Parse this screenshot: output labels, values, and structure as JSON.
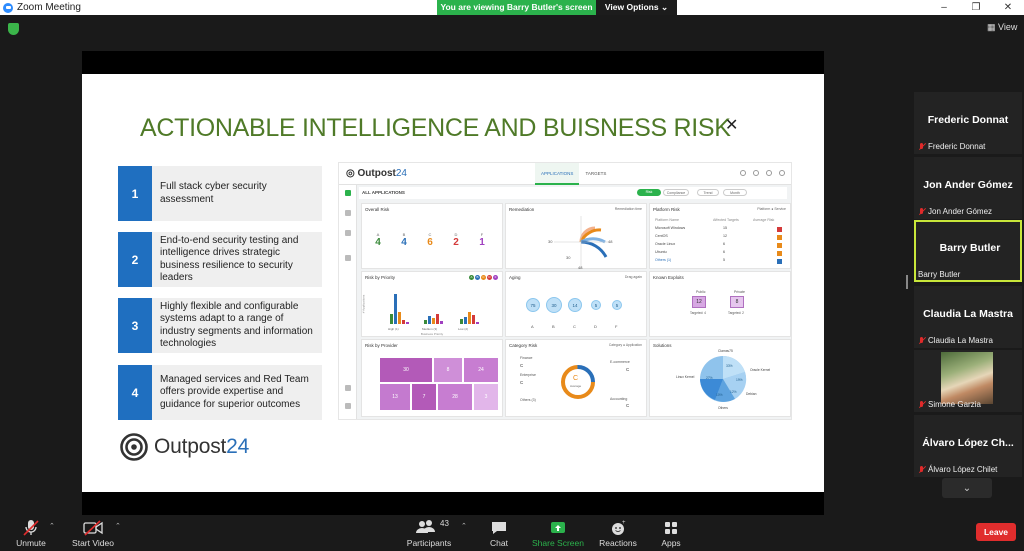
{
  "window": {
    "title": "Zoom Meeting",
    "controls": [
      "–",
      "❐",
      "✕"
    ]
  },
  "share_bar": {
    "message": "You are viewing Barry Butler's screen",
    "view_options": "View Options ⌄"
  },
  "view_button": "View",
  "slide": {
    "title": "ACTIONABLE INTELLIGENCE AND BUISNESS RISK",
    "points": [
      {
        "num": "1",
        "text": "Full stack cyber security assessment"
      },
      {
        "num": "2",
        "text": "End-to-end security testing and intelligence drives strategic business resilience to security leaders"
      },
      {
        "num": "3",
        "text": "Highly flexible and configurable systems adapt to a range of industry segments and information technologies"
      },
      {
        "num": "4",
        "text": "Managed services and Red Team offers provide expertise and guidance for superior outcomes"
      }
    ],
    "logo": {
      "part1": "Outpost",
      "part2": "24"
    }
  },
  "dashboard": {
    "logo_part1": "Outpost",
    "logo_part2": "24",
    "tabs": [
      "APPLICATIONS",
      "TARGETS"
    ],
    "subheader": "ALL APPLICATIONS",
    "toggles": [
      "Risk",
      "Compliance",
      "Trend",
      "Month"
    ],
    "overall_risk": {
      "title": "Overall Risk",
      "items": [
        {
          "label": "A",
          "value": "4",
          "color": "#3a8a3a"
        },
        {
          "label": "B",
          "value": "4",
          "color": "#2a6fb8"
        },
        {
          "label": "C",
          "value": "6",
          "color": "#e88a1a"
        },
        {
          "label": "D",
          "value": "2",
          "color": "#d43a3a"
        },
        {
          "label": "F",
          "value": "1",
          "color": "#a040c0"
        }
      ]
    },
    "remediation": {
      "title": "Remediation",
      "link": "Remediation time",
      "axis": [
        "30",
        "30",
        "48",
        "48"
      ]
    },
    "platform_risk": {
      "title": "Platform Risk",
      "toggle_a": "Platform",
      "toggle_b": "Service",
      "headers": [
        "Platform Name",
        "Affected Targets",
        "Average Risk"
      ],
      "rows": [
        {
          "name": "Microsoft Windows",
          "count": "15",
          "color": "#d43a3a"
        },
        {
          "name": "CentOS",
          "count": "12",
          "color": "#e88a1a"
        },
        {
          "name": "Oracle Linux",
          "count": "6",
          "color": "#e88a1a"
        },
        {
          "name": "Ubuntu",
          "count": "6",
          "color": "#e88a1a"
        },
        {
          "name": "Others (1)",
          "count": "5",
          "color": "#2a6fb8"
        }
      ]
    },
    "risk_by_priority": {
      "title": "Risk by Priority",
      "groups": [
        "High (1)",
        "Medium (3)",
        "Low (2)"
      ],
      "xlabel": "Business Priority",
      "ylabel": "# Applications",
      "legend": [
        "A",
        "B",
        "C",
        "D",
        "F"
      ]
    },
    "aging": {
      "title": "Aging",
      "link": "Drag again",
      "circles": [
        "75",
        "30",
        "14",
        "5",
        "5"
      ],
      "labels": [
        "A",
        "B",
        "C",
        "D",
        "F"
      ],
      "extra": "104"
    },
    "known_exploits": {
      "title": "Known Exploits",
      "public_label": "Public",
      "public_value": "12",
      "public_sub": "Targeted: 4",
      "private_label": "Private",
      "private_value": "8",
      "private_sub": "Targeted: 2"
    },
    "risk_by_provider": {
      "title": "Risk by Provider",
      "cells": [
        "30",
        "8",
        "24",
        "13",
        "7",
        "28",
        "3"
      ]
    },
    "category_risk": {
      "title": "Category Risk",
      "toggle_a": "Category",
      "toggle_b": "Application",
      "left": [
        "Finance",
        "C",
        "Enterprise",
        "C",
        "Others (3)"
      ],
      "right": [
        "E-commerce",
        "C",
        "Accounting",
        "C"
      ],
      "center_grade": "C",
      "center_sub": "Average"
    },
    "solutions": {
      "title": "Solutions",
      "labels": [
        "Clamav75",
        "Oracle Kernel",
        "Linux Kernel",
        "Debian",
        "Others"
      ],
      "pcts": [
        "33%",
        "19%",
        "27%",
        "12%",
        "10%"
      ]
    }
  },
  "participants": [
    {
      "name": "Frederic Donnat",
      "label": "Frederic Donnat",
      "muted": true
    },
    {
      "name": "Jon Ander Gómez",
      "label": "Jon Ander Gómez",
      "muted": true
    },
    {
      "name": "Barry Butler",
      "label": "Barry Butler",
      "muted": false,
      "active": true
    },
    {
      "name": "Claudia La Mastra",
      "label": "Claudia La Mastra",
      "muted": true
    },
    {
      "name": "",
      "label": "Simone Garzia",
      "muted": true,
      "video": true
    },
    {
      "name": "Álvaro López Ch...",
      "label": "Álvaro López Chilet",
      "muted": true
    }
  ],
  "toolbar": {
    "unmute": "Unmute",
    "start_video": "Start Video",
    "participants": "Participants",
    "participants_count": "43",
    "chat": "Chat",
    "share_screen": "Share Screen",
    "reactions": "Reactions",
    "apps": "Apps",
    "leave": "Leave"
  },
  "colors": {
    "accent_green": "#2bb24c",
    "leave_red": "#e02d2d",
    "slide_title_green": "#4f7a28",
    "point_blue": "#1f6fc0"
  }
}
